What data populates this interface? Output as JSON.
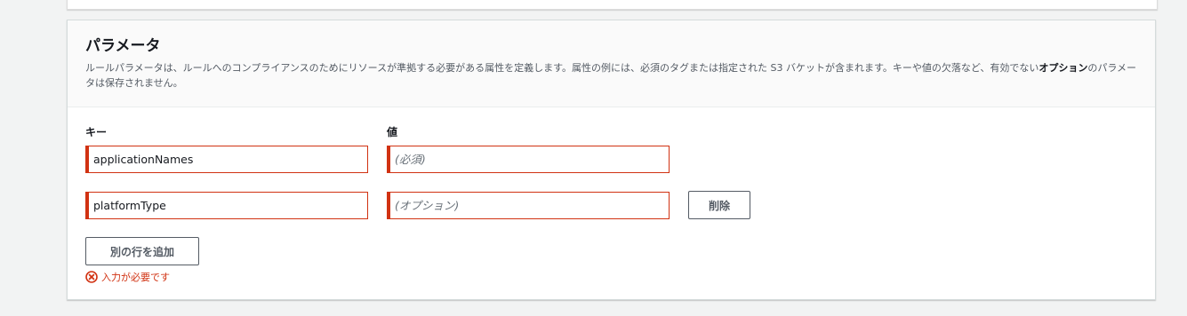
{
  "parameters": {
    "title": "パラメータ",
    "description_main": "ルールパラメータは、ルールへのコンプライアンスのためにリソースが準拠する必要がある属性を定義します。属性の例には、必須のタグまたは指定された S3 バケットが含まれます。キーや値の欠落など、有効でない",
    "description_bold": "オプション",
    "description_tail": "のパラメータは保存されません。",
    "key_label": "キー",
    "value_label": "値",
    "rows": [
      {
        "key": "applicationNames",
        "value": "",
        "value_placeholder": "(必須)"
      },
      {
        "key": "platformType",
        "value": "",
        "value_placeholder": "(オプション)",
        "remove_label": "削除"
      }
    ],
    "add_row_label": "別の行を追加",
    "error_icon": "error-circle-x-icon",
    "error_text": "入力が必要です"
  },
  "colors": {
    "error": "#d13212",
    "button_border": "#545b64",
    "header_bg": "#fafafa"
  }
}
